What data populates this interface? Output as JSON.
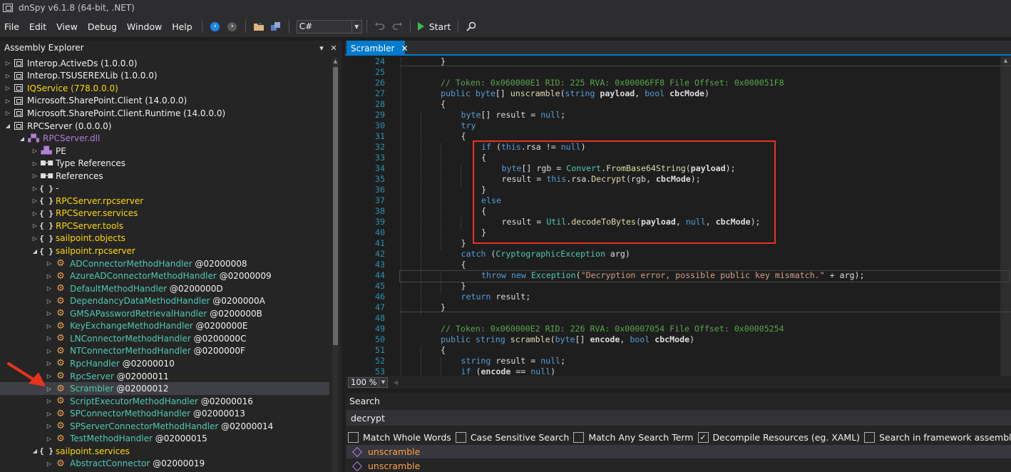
{
  "window": {
    "title": "dnSpy v6.1.8 (64-bit, .NET)"
  },
  "menu": [
    "File",
    "Edit",
    "View",
    "Debug",
    "Window",
    "Help"
  ],
  "toolbar": {
    "language": "C#",
    "start_label": "Start"
  },
  "explorer": {
    "title": "Assembly Explorer",
    "items": [
      {
        "label": "Interop.ActiveDs",
        "suffix": " (1.0.0.0)",
        "icon": "assembly-icon",
        "expanded": false,
        "color": "white"
      },
      {
        "label": "Interop.TSUSEREXLib",
        "suffix": " (1.0.0.0)",
        "icon": "assembly-icon",
        "expanded": false,
        "color": "white"
      },
      {
        "label": "IQService",
        "suffix": " (778.0.0.0)",
        "icon": "assembly-icon",
        "expanded": false,
        "color": "yellow"
      },
      {
        "label": "Microsoft.SharePoint.Client",
        "suffix": " (14.0.0.0)",
        "icon": "assembly-icon",
        "expanded": false,
        "color": "white"
      },
      {
        "label": "Microsoft.SharePoint.Client.Runtime",
        "suffix": " (14.0.0.0)",
        "icon": "assembly-icon",
        "expanded": false,
        "color": "white"
      },
      {
        "label": "RPCServer",
        "suffix": " (0.0.0.0)",
        "icon": "assembly-icon",
        "expanded": true,
        "color": "white"
      },
      {
        "label": "RPCServer.dll",
        "suffix": "",
        "icon": "dll-icon",
        "expanded": true,
        "color": "purple"
      },
      {
        "label": "PE",
        "suffix": "",
        "icon": "pe-icon",
        "expanded": false,
        "color": "white"
      },
      {
        "label": "Type References",
        "suffix": "",
        "icon": "references-icon",
        "expanded": false,
        "color": "white"
      },
      {
        "label": "References",
        "suffix": "",
        "icon": "references-icon",
        "expanded": false,
        "color": "white"
      },
      {
        "label": "-",
        "suffix": "",
        "icon": "namespace-icon",
        "expanded": false,
        "color": "white"
      },
      {
        "label": "RPCServer.rpcserver",
        "suffix": "",
        "icon": "namespace-icon",
        "expanded": false,
        "color": "yellow"
      },
      {
        "label": "RPCServer.services",
        "suffix": "",
        "icon": "namespace-icon",
        "expanded": false,
        "color": "yellow"
      },
      {
        "label": "RPCServer.tools",
        "suffix": "",
        "icon": "namespace-icon",
        "expanded": false,
        "color": "yellow"
      },
      {
        "label": "sailpoint.objects",
        "suffix": "",
        "icon": "namespace-icon",
        "expanded": false,
        "color": "yellow"
      },
      {
        "label": "sailpoint.rpcserver",
        "suffix": "",
        "icon": "namespace-icon",
        "expanded": true,
        "color": "yellow"
      },
      {
        "label": "ADConnectorMethodHandler",
        "suffix": " @02000008",
        "icon": "class-icon",
        "expanded": false,
        "color": "teal"
      },
      {
        "label": "AzureADConnectorMethodHandler",
        "suffix": " @02000009",
        "icon": "class-icon",
        "expanded": false,
        "color": "teal"
      },
      {
        "label": "DefaultMethodHandler",
        "suffix": " @0200000D",
        "icon": "class-icon",
        "expanded": false,
        "color": "teal"
      },
      {
        "label": "DependancyDataMethodHandler",
        "suffix": " @0200000A",
        "icon": "class-icon",
        "expanded": false,
        "color": "teal"
      },
      {
        "label": "GMSAPasswordRetrievalHandler",
        "suffix": " @0200000B",
        "icon": "class-icon",
        "expanded": false,
        "color": "teal"
      },
      {
        "label": "KeyExchangeMethodHandler",
        "suffix": " @0200000E",
        "icon": "class-icon",
        "expanded": false,
        "color": "teal"
      },
      {
        "label": "LNConnectorMethodHandler",
        "suffix": " @0200000C",
        "icon": "class-icon",
        "expanded": false,
        "color": "teal"
      },
      {
        "label": "NTConnectorMethodHandler",
        "suffix": " @0200000F",
        "icon": "class-icon",
        "expanded": false,
        "color": "teal"
      },
      {
        "label": "RpcHandler",
        "suffix": " @02000010",
        "icon": "class-icon",
        "expanded": false,
        "color": "teal"
      },
      {
        "label": "RpcServer",
        "suffix": " @02000011",
        "icon": "class-icon",
        "expanded": false,
        "color": "teal"
      },
      {
        "label": "Scrambler",
        "suffix": " @02000012",
        "icon": "class-icon",
        "expanded": false,
        "color": "teal",
        "selected": true
      },
      {
        "label": "ScriptExecutorMethodHandler",
        "suffix": " @02000016",
        "icon": "class-icon",
        "expanded": false,
        "color": "teal"
      },
      {
        "label": "SPConnectorMethodHandler",
        "suffix": " @02000013",
        "icon": "class-icon",
        "expanded": false,
        "color": "teal"
      },
      {
        "label": "SPServerConnectorMethodHandler",
        "suffix": " @02000014",
        "icon": "class-icon",
        "expanded": false,
        "color": "teal"
      },
      {
        "label": "TestMethodHandler",
        "suffix": " @02000015",
        "icon": "class-icon",
        "expanded": false,
        "color": "teal"
      },
      {
        "label": "sailpoint.services",
        "suffix": "",
        "icon": "namespace-icon",
        "expanded": true,
        "color": "yellow"
      },
      {
        "label": "AbstractConnector",
        "suffix": " @02000019",
        "icon": "class-icon",
        "expanded": false,
        "color": "teal"
      }
    ]
  },
  "editor": {
    "tab": "Scrambler",
    "zoom": "100 %",
    "lines": [
      {
        "n": "24",
        "code": [
          [
            "",
            "}"
          ]
        ],
        "indent": 0
      },
      {
        "n": "25",
        "code": [],
        "indent": 0
      },
      {
        "n": "26",
        "code": [
          [
            "cm",
            "// Token: 0x060000E1 RID: 225 RVA: 0x00006FF8 File Offset: 0x000051F8"
          ]
        ],
        "indent": 0
      },
      {
        "n": "27",
        "code": [
          [
            "kw",
            "public "
          ],
          [
            "kw",
            "byte"
          ],
          [
            "",
            "[] "
          ],
          [
            "mt",
            "unscramble"
          ],
          [
            "",
            "("
          ],
          [
            "kw",
            "string "
          ],
          [
            "pm",
            "payload"
          ],
          [
            "",
            ", "
          ],
          [
            "kw",
            "bool "
          ],
          [
            "pm",
            "cbcMode"
          ],
          [
            "",
            ")"
          ]
        ],
        "indent": 0
      },
      {
        "n": "28",
        "code": [
          [
            "",
            "{"
          ]
        ],
        "indent": 0
      },
      {
        "n": "29",
        "code": [
          [
            "kw",
            "byte"
          ],
          [
            "",
            "[] result = "
          ],
          [
            "kw",
            "null"
          ],
          [
            "",
            ";"
          ]
        ],
        "indent": 1
      },
      {
        "n": "30",
        "code": [
          [
            "kw",
            "try"
          ]
        ],
        "indent": 1
      },
      {
        "n": "31",
        "code": [
          [
            "",
            "{"
          ]
        ],
        "indent": 1
      },
      {
        "n": "32",
        "code": [
          [
            "kw",
            "if "
          ],
          [
            "",
            "("
          ],
          [
            "kw",
            "this"
          ],
          [
            "",
            ".rsa != "
          ],
          [
            "kw",
            "null"
          ],
          [
            "",
            ")"
          ]
        ],
        "indent": 2
      },
      {
        "n": "33",
        "code": [
          [
            "",
            "{"
          ]
        ],
        "indent": 2
      },
      {
        "n": "34",
        "code": [
          [
            "kw",
            "byte"
          ],
          [
            "",
            "[] rgb = "
          ],
          [
            "ty",
            "Convert"
          ],
          [
            "",
            "."
          ],
          [
            "mt",
            "FromBase64String"
          ],
          [
            "",
            "("
          ],
          [
            "pm",
            "payload"
          ],
          [
            "",
            ");"
          ]
        ],
        "indent": 3
      },
      {
        "n": "35",
        "code": [
          [
            "",
            "result = "
          ],
          [
            "kw",
            "this"
          ],
          [
            "",
            ".rsa."
          ],
          [
            "mt",
            "Decrypt"
          ],
          [
            "",
            "(rgb, "
          ],
          [
            "pm",
            "cbcMode"
          ],
          [
            "",
            ");"
          ]
        ],
        "indent": 3
      },
      {
        "n": "36",
        "code": [
          [
            "",
            "}"
          ]
        ],
        "indent": 2
      },
      {
        "n": "37",
        "code": [
          [
            "kw",
            "else"
          ]
        ],
        "indent": 2
      },
      {
        "n": "38",
        "code": [
          [
            "",
            "{"
          ]
        ],
        "indent": 2
      },
      {
        "n": "39",
        "code": [
          [
            "",
            "result = "
          ],
          [
            "ty",
            "Util"
          ],
          [
            "",
            "."
          ],
          [
            "mt",
            "decodeToBytes"
          ],
          [
            "",
            "("
          ],
          [
            "pm",
            "payload"
          ],
          [
            "",
            ", "
          ],
          [
            "kw",
            "null"
          ],
          [
            "",
            ", "
          ],
          [
            "pm",
            "cbcMode"
          ],
          [
            "",
            ");"
          ]
        ],
        "indent": 3
      },
      {
        "n": "40",
        "code": [
          [
            "",
            "}"
          ]
        ],
        "indent": 2
      },
      {
        "n": "41",
        "code": [
          [
            "",
            "}"
          ]
        ],
        "indent": 1
      },
      {
        "n": "42",
        "code": [
          [
            "kw",
            "catch "
          ],
          [
            "",
            "("
          ],
          [
            "ty",
            "CryptographicException "
          ],
          [
            "",
            "arg)"
          ]
        ],
        "indent": 1
      },
      {
        "n": "43",
        "code": [
          [
            "",
            "{"
          ]
        ],
        "indent": 1
      },
      {
        "n": "44",
        "code": [
          [
            "kw",
            "throw new "
          ],
          [
            "ty",
            "Exception"
          ],
          [
            "",
            "("
          ],
          [
            "st",
            "\"Decryption error, possible public key mismatch.\""
          ],
          [
            "",
            " + arg);"
          ]
        ],
        "indent": 2
      },
      {
        "n": "45",
        "code": [
          [
            "",
            "}"
          ]
        ],
        "indent": 1
      },
      {
        "n": "46",
        "code": [
          [
            "kw",
            "return "
          ],
          [
            "",
            "result;"
          ]
        ],
        "indent": 1
      },
      {
        "n": "47",
        "code": [
          [
            "",
            "}"
          ]
        ],
        "indent": 0
      },
      {
        "n": "48",
        "code": [],
        "indent": 0
      },
      {
        "n": "49",
        "code": [
          [
            "cm",
            "// Token: 0x060000E2 RID: 226 RVA: 0x00007054 File Offset: 0x00005254"
          ]
        ],
        "indent": 0
      },
      {
        "n": "50",
        "code": [
          [
            "kw",
            "public "
          ],
          [
            "kw",
            "string "
          ],
          [
            "mt",
            "scramble"
          ],
          [
            "",
            "("
          ],
          [
            "kw",
            "byte"
          ],
          [
            "",
            "[] "
          ],
          [
            "pm",
            "encode"
          ],
          [
            "",
            ", "
          ],
          [
            "kw",
            "bool "
          ],
          [
            "pm",
            "cbcMode"
          ],
          [
            "",
            ")"
          ]
        ],
        "indent": 0
      },
      {
        "n": "51",
        "code": [
          [
            "",
            "{"
          ]
        ],
        "indent": 0
      },
      {
        "n": "52",
        "code": [
          [
            "kw",
            "string "
          ],
          [
            "",
            "result = "
          ],
          [
            "kw",
            "null"
          ],
          [
            "",
            ";"
          ]
        ],
        "indent": 1
      },
      {
        "n": "53",
        "code": [
          [
            "kw",
            "if "
          ],
          [
            "",
            "("
          ],
          [
            "pm",
            "encode"
          ],
          [
            "",
            " == "
          ],
          [
            "kw",
            "null"
          ],
          [
            "",
            ")"
          ]
        ],
        "indent": 1
      }
    ]
  },
  "search": {
    "title": "Search",
    "query": "decrypt",
    "options": [
      {
        "label": "Match Whole Words",
        "checked": false
      },
      {
        "label": "Case Sensitive Search",
        "checked": false
      },
      {
        "label": "Match Any Search Term",
        "checked": false
      },
      {
        "label": "Decompile Resources (eg. XAML)",
        "checked": true
      },
      {
        "label": "Search in framework assemblies",
        "checked": false
      }
    ],
    "results": [
      "unscramble",
      "unscramble"
    ]
  },
  "colors": {
    "accent": "#007acc",
    "highlight": "#e8331f",
    "annotation_arrow": "#e8331f"
  }
}
